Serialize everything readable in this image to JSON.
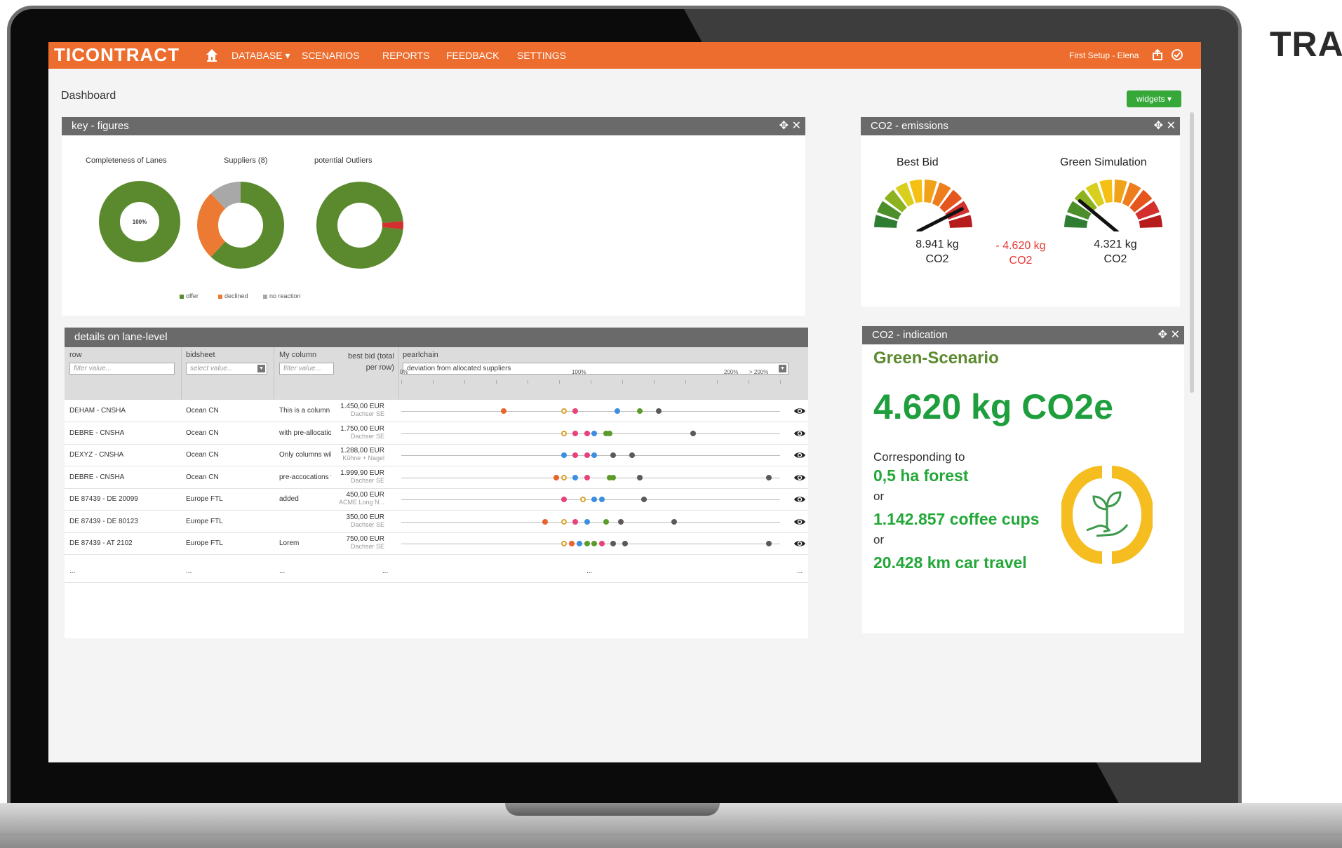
{
  "brand_corner": "TRA",
  "nav": {
    "logo": "TICONTRACT",
    "items": [
      "DATABASE ▾",
      "SCENARIOS",
      "REPORTS",
      "FEEDBACK",
      "SETTINGS"
    ],
    "user": "First Setup - Elena",
    "color": "#ec6d2d"
  },
  "page": {
    "title": "Dashboard",
    "widgets_button": "widgets ▾"
  },
  "key_figures": {
    "title": "key - figures",
    "completeness": {
      "label": "Completeness of Lanes",
      "center_text": "100%",
      "percent": 100
    },
    "suppliers": {
      "label": "Suppliers (8)",
      "segments": [
        {
          "name": "offer",
          "share": 0.62,
          "color": "#5b8a2e"
        },
        {
          "name": "declined",
          "share": 0.26,
          "color": "#ec7a33"
        },
        {
          "name": "no reaction",
          "share": 0.12,
          "color": "#a8a8a8"
        }
      ]
    },
    "outliers": {
      "label": "potential Outliers",
      "outlier_share": 0.03,
      "colors": [
        "#5b8a2e",
        "#d32f2f"
      ]
    },
    "legend": [
      "offer",
      "declined",
      "no reaction"
    ]
  },
  "co2_emissions": {
    "title": "CO2 - emissions",
    "best_bid": {
      "label": "Best Bid",
      "value": "8.941 kg",
      "unit": "CO2",
      "needle_level": 0.85
    },
    "difference": {
      "value": "- 4.620 kg",
      "unit": "CO2"
    },
    "green_simulation": {
      "label": "Green Simulation",
      "value": "4.321 kg",
      "unit": "CO2",
      "needle_level": 0.22
    }
  },
  "co2_indication": {
    "title": "CO2 - indication",
    "scenario": "Green-Scenario",
    "amount": "4.620 kg CO2e",
    "corresponding": "Corresponding to",
    "or": "or",
    "equivalents": [
      "0,5 ha forest",
      "1.142.857 coffee cups",
      "20.428 km car travel"
    ],
    "icon": "plant-in-hand-icon"
  },
  "lanes": {
    "title": "details on  lane-level",
    "headers": {
      "row": "row",
      "bidsheet": "bidsheet",
      "my_column": "My column",
      "best_bid": "best bid (total per row)",
      "pearlchain": "pearlchain"
    },
    "filters": {
      "row": "filter value...",
      "bidsheet": "select value...",
      "my_column": "filter value...",
      "pearlchain": "deviation from allocated suppliers"
    },
    "axis": [
      "0%",
      "100%",
      "200%",
      "> 200%"
    ],
    "rows": [
      {
        "row": "DEHAM - CNSHA",
        "bidsheet": "Ocean CN",
        "my_column": "This is a column",
        "bid": "1.450,00 EUR",
        "supplier": "Dachser SE",
        "pearls": [
          [
            0.27,
            "#e8642b",
            0
          ],
          [
            0.43,
            "#d9a32d",
            1
          ],
          [
            0.46,
            "#e8427a",
            0
          ],
          [
            0.57,
            "#3c8fe0",
            0
          ],
          [
            0.63,
            "#5b9b2b",
            0
          ],
          [
            0.68,
            "#5a5a5a",
            0
          ]
        ]
      },
      {
        "row": "DEBRE - CNSHA",
        "bidsheet": "Ocean CN",
        "my_column": "with pre-allocations",
        "bid": "1.750,00 EUR",
        "supplier": "Dachser SE",
        "pearls": [
          [
            0.43,
            "#d9a32d",
            1
          ],
          [
            0.46,
            "#e8427a",
            0
          ],
          [
            0.49,
            "#e8427a",
            0
          ],
          [
            0.51,
            "#3c8fe0",
            0
          ],
          [
            0.54,
            "#5b9b2b",
            0
          ],
          [
            0.55,
            "#5b9b2b",
            0
          ],
          [
            0.77,
            "#5a5a5a",
            0
          ]
        ]
      },
      {
        "row": "DEXYZ - CNSHA",
        "bidsheet": "Ocean CN",
        "my_column": "Only columns will",
        "bid": "1.288,00 EUR",
        "supplier": "Kühne + Nagel",
        "pearls": [
          [
            0.43,
            "#3c8fe0",
            0
          ],
          [
            0.46,
            "#e8427a",
            0
          ],
          [
            0.49,
            "#e8427a",
            0
          ],
          [
            0.51,
            "#3c8fe0",
            0
          ],
          [
            0.56,
            "#5a5a5a",
            0
          ],
          [
            0.61,
            "#5a5a5a",
            0
          ]
        ]
      },
      {
        "row": "DEBRE - CNSHA",
        "bidsheet": "Ocean CN",
        "my_column": "pre-accocations will",
        "bid": "1.999,90 EUR",
        "supplier": "Dachser SE",
        "pearls": [
          [
            0.41,
            "#e8642b",
            0
          ],
          [
            0.43,
            "#d9a32d",
            1
          ],
          [
            0.46,
            "#3c8fe0",
            0
          ],
          [
            0.49,
            "#e8427a",
            0
          ],
          [
            0.55,
            "#5b9b2b",
            0
          ],
          [
            0.56,
            "#5b9b2b",
            0
          ],
          [
            0.63,
            "#5a5a5a",
            0
          ],
          [
            0.97,
            "#5a5a5a",
            0
          ]
        ]
      },
      {
        "row": "DE 87439 - DE 20099",
        "bidsheet": "Europe FTL",
        "my_column": "added",
        "bid": "450,00 EUR",
        "supplier": "ACME Long N...",
        "pearls": [
          [
            0.43,
            "#e8427a",
            0
          ],
          [
            0.48,
            "#d9a32d",
            1
          ],
          [
            0.51,
            "#3c8fe0",
            0
          ],
          [
            0.53,
            "#3c8fe0",
            0
          ],
          [
            0.64,
            "#5a5a5a",
            0
          ]
        ]
      },
      {
        "row": "DE 87439 - DE 80123",
        "bidsheet": "Europe FTL",
        "my_column": "",
        "bid": "350,00 EUR",
        "supplier": "Dachser SE",
        "pearls": [
          [
            0.38,
            "#e8642b",
            0
          ],
          [
            0.43,
            "#d9a32d",
            1
          ],
          [
            0.46,
            "#e8427a",
            0
          ],
          [
            0.49,
            "#3c8fe0",
            0
          ],
          [
            0.54,
            "#5b9b2b",
            0
          ],
          [
            0.58,
            "#5a5a5a",
            0
          ],
          [
            0.72,
            "#5a5a5a",
            0
          ]
        ]
      },
      {
        "row": "DE 87439 - AT 2102",
        "bidsheet": "Europe FTL",
        "my_column": "Lorem",
        "bid": "750,00 EUR",
        "supplier": "Dachser SE",
        "pearls": [
          [
            0.43,
            "#d9a32d",
            1
          ],
          [
            0.45,
            "#e8642b",
            0
          ],
          [
            0.47,
            "#3c8fe0",
            0
          ],
          [
            0.49,
            "#5b9b2b",
            0
          ],
          [
            0.51,
            "#5b9b2b",
            0
          ],
          [
            0.53,
            "#e8427a",
            0
          ],
          [
            0.56,
            "#5a5a5a",
            0
          ],
          [
            0.59,
            "#5a5a5a",
            0
          ],
          [
            0.97,
            "#5a5a5a",
            0
          ]
        ]
      }
    ],
    "ellipsis": "..."
  }
}
